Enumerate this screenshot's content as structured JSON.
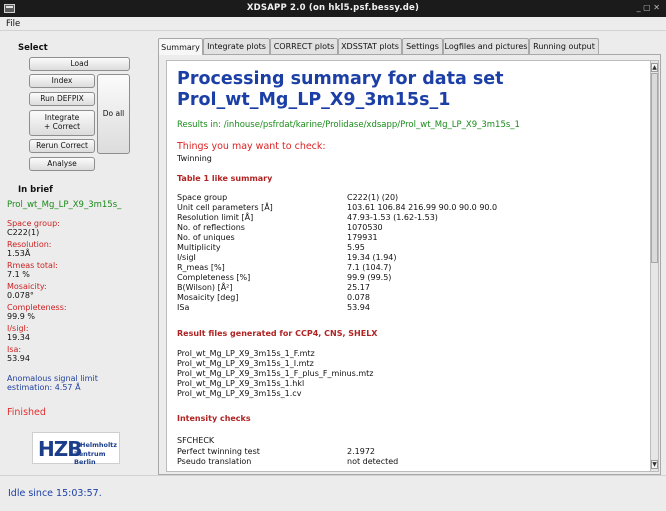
{
  "window": {
    "title": "XDSAPP 2.0 (on hkl5.psf.bessy.de)",
    "controls": "_ ▢ ✕"
  },
  "menu": {
    "file": "File"
  },
  "sidebar": {
    "select_label": "Select",
    "buttons": {
      "load": "Load",
      "index": "Index",
      "run_defpix": "Run DEFPIX",
      "integrate_correct": "Integrate\n+ Correct",
      "do_all": "Do all",
      "rerun_correct": "Rerun Correct",
      "analyse": "Analyse"
    },
    "in_brief_label": "In brief",
    "dataset": "Prol_wt_Mg_LP_X9_3m15s_",
    "brief": [
      {
        "label": "Space group:",
        "value": "C222(1)"
      },
      {
        "label": "Resolution:",
        "value": "1.53Å"
      },
      {
        "label": "Rmeas total:",
        "value": "7.1 %"
      },
      {
        "label": "Mosaicity:",
        "value": "0.078°"
      },
      {
        "label": "Completeness:",
        "value": "99.9 %"
      },
      {
        "label": "I/sigI:",
        "value": "19.34"
      },
      {
        "label": "Isa:",
        "value": "53.94"
      }
    ],
    "anomalous_line1": "Anomalous signal limit",
    "anomalous_line2": "estimation: 4.57 Å",
    "finished": "Finished",
    "logo": {
      "main": "HZB",
      "line1": "Helmholtz",
      "line2": "Zentrum Berlin"
    }
  },
  "tabs": [
    {
      "label": "Summary",
      "active": true
    },
    {
      "label": "Integrate plots",
      "active": false
    },
    {
      "label": "CORRECT plots",
      "active": false
    },
    {
      "label": "XDSSTAT plots",
      "active": false
    },
    {
      "label": "Settings",
      "active": false
    },
    {
      "label": "Logfiles and pictures",
      "active": false
    },
    {
      "label": "Running output",
      "active": false
    }
  ],
  "summary": {
    "title_line1": "Processing summary for data set",
    "title_line2": "Prol_wt_Mg_LP_X9_3m15s_1",
    "results_in": "Results in: /inhouse/psfrdat/karine/Prolidase/xdsapp/Prol_wt_Mg_LP_X9_3m15s_1",
    "things_heading": "Things you may want to check:",
    "things_item": "Twinning",
    "table1_heading": "Table 1 like summary",
    "table1": [
      {
        "key": "Space group",
        "value": "C222(1) (20)"
      },
      {
        "key": "Unit cell parameters [Å]",
        "value": "103.61 106.84 216.99 90.0 90.0 90.0"
      },
      {
        "key": "Resolution limit [Å]",
        "value": "47.93-1.53 (1.62-1.53)"
      },
      {
        "key": "No. of reflections",
        "value": "1070530"
      },
      {
        "key": "No. of uniques",
        "value": "179931"
      },
      {
        "key": "Multiplicity",
        "value": "5.95"
      },
      {
        "key": "I/sigI",
        "value": "19.34 (1.94)"
      },
      {
        "key": "R_meas [%]",
        "value": "7.1 (104.7)"
      },
      {
        "key": "Completeness [%]",
        "value": "99.9 (99.5)"
      },
      {
        "key": "B(Wilson) [Å²]",
        "value": "25.17"
      },
      {
        "key": "Mosaicity [deg]",
        "value": "0.078"
      },
      {
        "key": "ISa",
        "value": "53.94"
      }
    ],
    "files_heading": "Result files generated for CCP4, CNS, SHELX",
    "files": [
      "Prol_wt_Mg_LP_X9_3m15s_1_F.mtz",
      "Prol_wt_Mg_LP_X9_3m15s_1_I.mtz",
      "Prol_wt_Mg_LP_X9_3m15s_1_F_plus_F_minus.mtz",
      "Prol_wt_Mg_LP_X9_3m15s_1.hkl",
      "Prol_wt_Mg_LP_X9_3m15s_1.cv"
    ],
    "intensity_heading": "Intensity checks",
    "sfcheck_label": "SFCHECK",
    "intensity": [
      {
        "key": "Perfect twinning test",
        "value": "2.1972"
      },
      {
        "key": "Pseudo translation",
        "value": "not detected"
      }
    ]
  },
  "status": "Idle since 15:03:57.",
  "colors": {
    "title_blue": "#1c3fa6",
    "results_green": "#1a8a1a",
    "label_red": "#cc2222",
    "section_red": "#b02323"
  }
}
